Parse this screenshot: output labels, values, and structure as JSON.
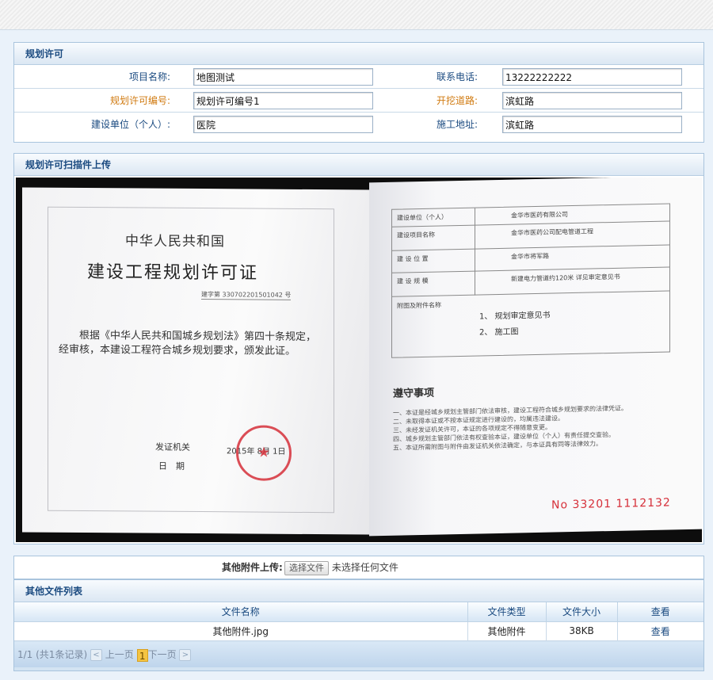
{
  "planning_permit": {
    "section_title": "规划许可",
    "fields": {
      "project_name_label": "项目名称:",
      "project_name_value": "地图测试",
      "phone_label": "联系电话:",
      "phone_value": "13222222222",
      "permit_no_label": "规划许可编号:",
      "permit_no_value": "规划许可编号1",
      "road_label": "开挖道路:",
      "road_value": "滨虹路",
      "builder_label": "建设单位（个人）:",
      "builder_value": "医院",
      "site_label": "施工地址:",
      "site_value": "滨虹路"
    }
  },
  "scan_upload": {
    "section_title": "规划许可扫描件上传",
    "document": {
      "country": "中华人民共和国",
      "title": "建设工程规划许可证",
      "number": "建字第 330702201501042 号",
      "body": "根据《中华人民共和国城乡规划法》第四十条规定，经审核，本建设工程符合城乡规划要求，颁发此证。",
      "issuer_label": "发证机关",
      "date_label": "日　期",
      "date_value": "2015年 8月 1日",
      "stamp_text": "★",
      "table_rows": [
        {
          "k": "建设单位（个人）",
          "v": "金华市医药有限公司"
        },
        {
          "k": "建设项目名称",
          "v": "金华市医药公司配电管道工程"
        },
        {
          "k": "建 设 位 置",
          "v": "金华市将军路"
        },
        {
          "k": "建 设 规 模",
          "v": "新建电力管道约120米 详见审定意见书"
        }
      ],
      "attachments_label": "附图及附件名称",
      "attachments": [
        "1、 规划审定意见书",
        "2、 施工图"
      ],
      "notes_title": "遵守事项",
      "notes": [
        "一、本证是经城乡规划主管部门依法审核，建设工程符合城乡规划要求的法律凭证。",
        "二、未取得本证或不按本证规定进行建设的，均属违法建设。",
        "三、未经发证机关许可，本证的各项规定不得随意变更。",
        "四、城乡规划主管部门依法有权查验本证，建设单位（个人）有责任提交查验。",
        "五、本证所需附图与附件由发证机关依法确定，与本证具有同等法律效力。"
      ],
      "serial": "No 33201 1112132"
    }
  },
  "other_upload": {
    "label": "其他附件上传:",
    "button_label": "选择文件",
    "status_text": "未选择任何文件"
  },
  "other_files": {
    "section_title": "其他文件列表",
    "columns": [
      "文件名称",
      "文件类型",
      "文件大小",
      "查看"
    ],
    "rows": [
      {
        "name": "其他附件.jpg",
        "type": "其他附件",
        "size": "38KB",
        "action": "查看"
      }
    ],
    "pager": {
      "summary": "1/1 (共1条记录)",
      "prev_label": "上一页",
      "current_page": "1",
      "next_label": "下一页",
      "prev_arrow": "<",
      "next_arrow": ">"
    }
  },
  "colors": {
    "accent": "#1a4a80",
    "orange_label": "#d07a10",
    "page_bg": "#eaf2fa",
    "stamp": "#d6303a"
  }
}
